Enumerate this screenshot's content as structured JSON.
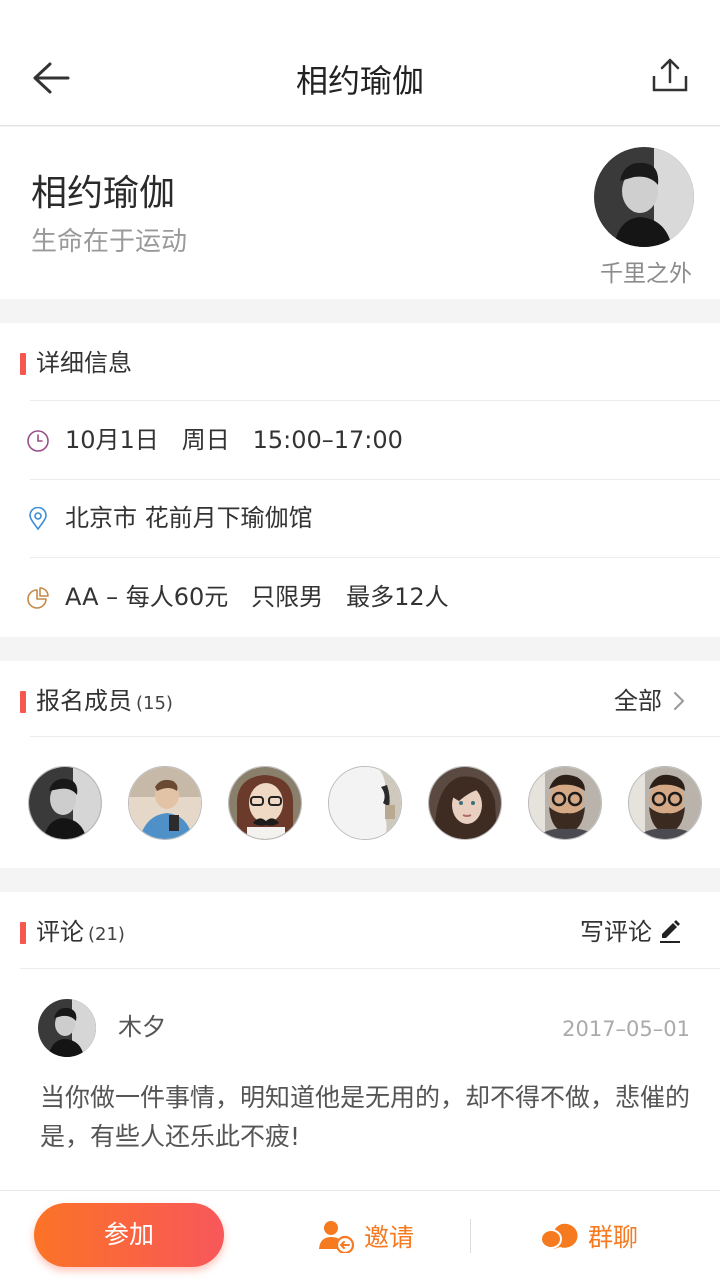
{
  "nav": {
    "title": "相约瑜伽"
  },
  "activity": {
    "title": "相约瑜伽",
    "subtitle": "生命在于运动",
    "host_name": "千里之外"
  },
  "details": {
    "title": "详细信息",
    "time": "10月1日   周日   15:00–17:00",
    "location": "北京市 花前月下瑜伽馆",
    "cost": "AA – 每人60元   只限男   最多12人"
  },
  "members": {
    "title": "报名成员",
    "count": "(15)",
    "all_label": "全部"
  },
  "comments": {
    "title": "评论",
    "count": "(21)",
    "write_label": "写评论",
    "items": [
      {
        "user": "木夕",
        "date": "2017–05–01",
        "text": "当你做一件事情，明知道他是无用的，却不得不做，悲催的是，有些人还乐此不疲!"
      }
    ]
  },
  "bottom": {
    "join_label": "参加",
    "invite_label": "邀请",
    "chat_label": "群聊"
  },
  "colors": {
    "accent": "#f57a20",
    "section_marker": "#f6574f",
    "join_gradient": [
      "#fb7326",
      "#f8575a"
    ]
  },
  "icons": [
    "back-arrow-icon",
    "share-icon",
    "clock-icon",
    "location-pin-icon",
    "pie-chart-icon",
    "chevron-right-icon",
    "pencil-icon",
    "invite-user-icon",
    "group-chat-icon"
  ]
}
